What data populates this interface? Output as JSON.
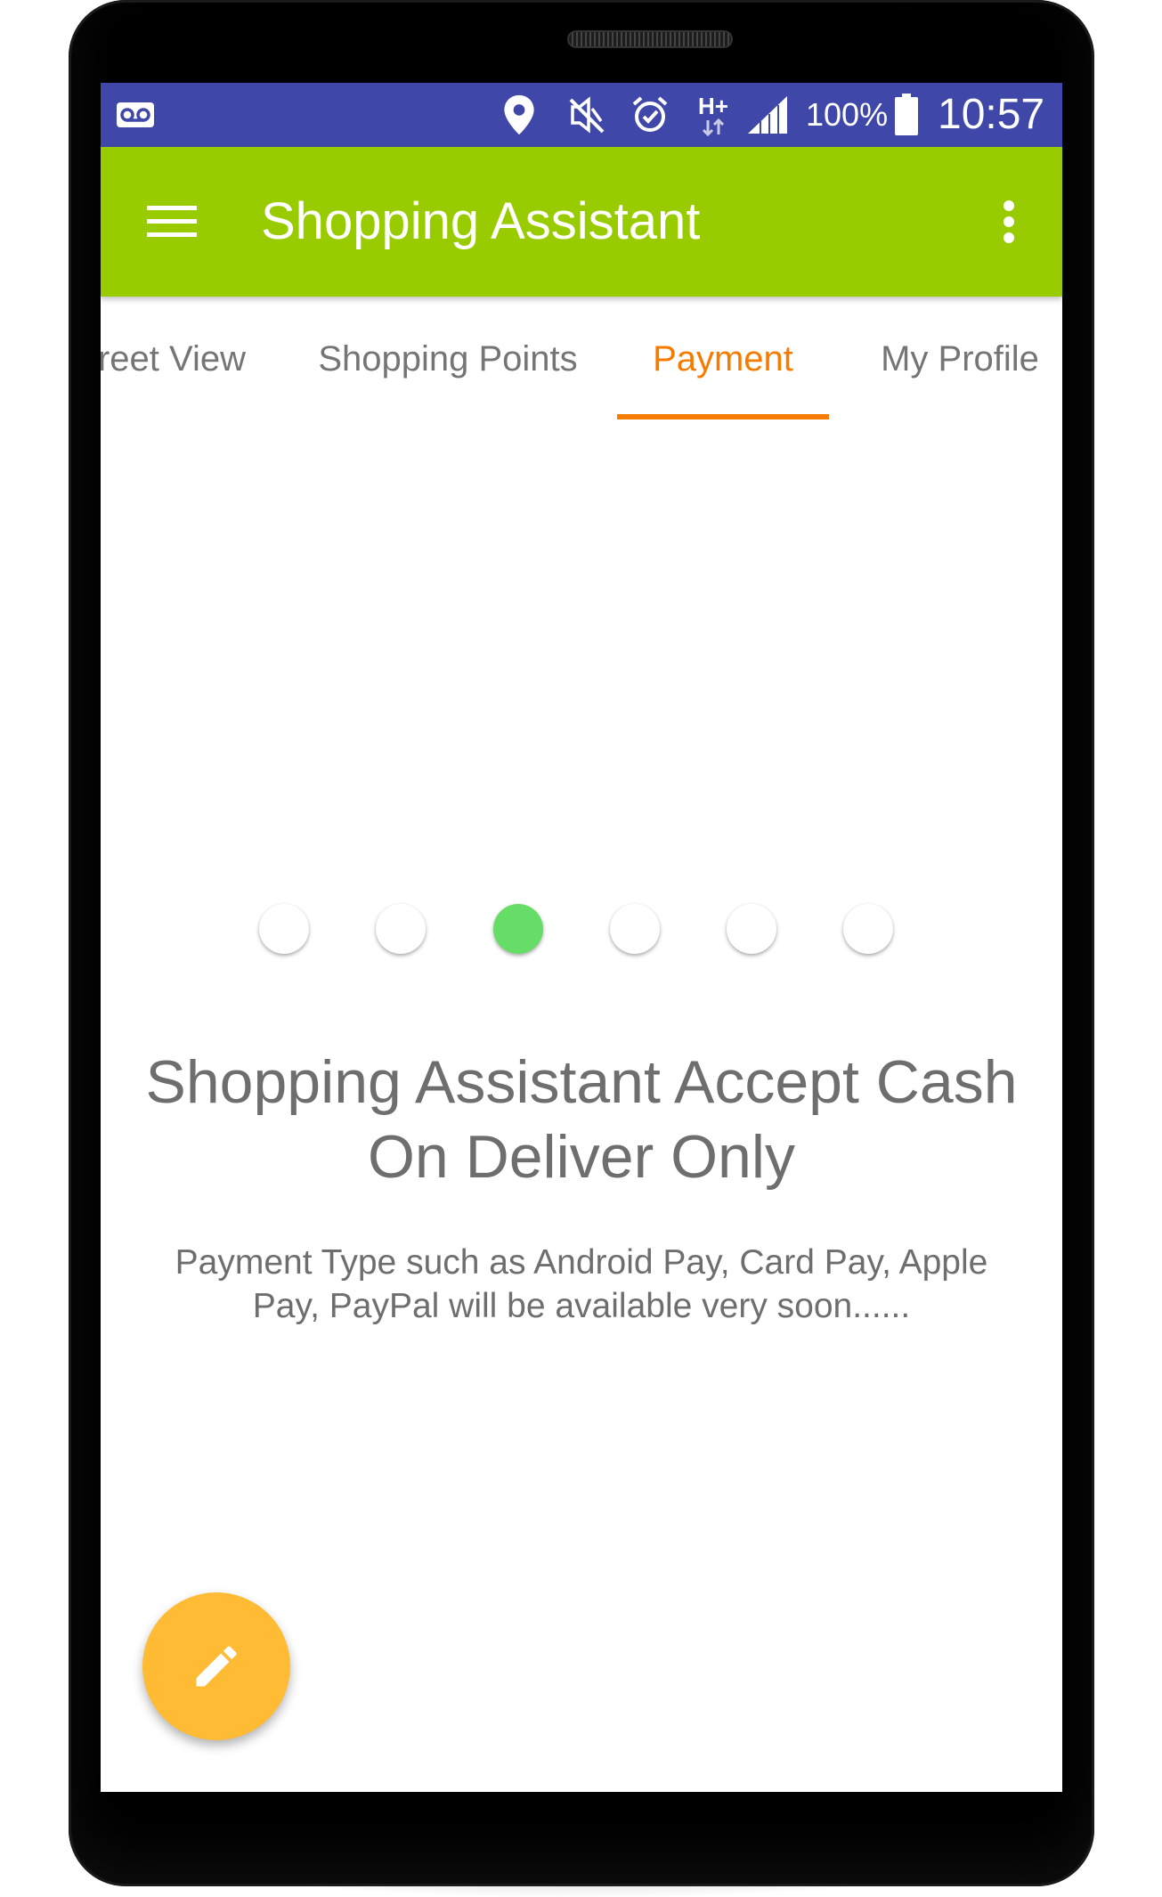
{
  "status_bar": {
    "voicemail_icon": "voicemail-icon",
    "location_icon": "location-icon",
    "mute_icon": "vibrate-off-icon",
    "alarm_icon": "alarm-icon",
    "network_type": "H+",
    "signal_icon": "signal-icon",
    "battery_percent": "100%",
    "battery_icon": "battery-icon",
    "time": "10:57",
    "background_color": "#3f48a8"
  },
  "app_bar": {
    "menu_icon": "hamburger-menu-icon",
    "title": "Shopping Assistant",
    "overflow_icon": "more-vert-icon",
    "background_color": "#99cc00"
  },
  "tabs": {
    "items": [
      {
        "label": "reet View",
        "active": false
      },
      {
        "label": "Shopping Points",
        "active": false
      },
      {
        "label": "Payment",
        "active": true
      },
      {
        "label": "My Profile",
        "active": false
      }
    ],
    "accent_color": "#f57c00"
  },
  "pager": {
    "count": 6,
    "active_index": 2,
    "active_color": "#66dd66"
  },
  "content": {
    "headline": "Shopping Assistant Accept Cash On Deliver Only",
    "body": "Payment Type such as Android Pay, Card Pay, Apple Pay, PayPal will be available very soon......"
  },
  "fab": {
    "icon": "pencil-edit-icon",
    "color": "#ffbb33"
  }
}
